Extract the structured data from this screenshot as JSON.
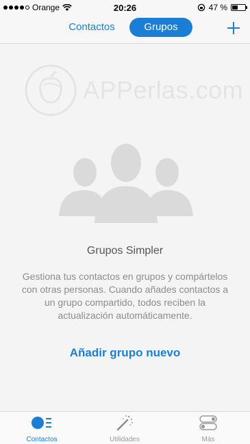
{
  "status_bar": {
    "carrier": "Orange",
    "time": "20:26",
    "battery": "47 %",
    "battery_level": 0.47
  },
  "header": {
    "segment_contactos": "Contactos",
    "segment_grupos": "Grupos",
    "add_icon": "plus-icon"
  },
  "watermark": {
    "text": "APPerlas.com"
  },
  "empty_state": {
    "icon": "people-group-icon",
    "title": "Grupos Simpler",
    "description": "Gestiona tus contactos en grupos y compártelos con otras personas. Cuando añades contactos a un grupo compartido, todos reciben la actualización automáticamente.",
    "action": "Añadir grupo nuevo"
  },
  "tabs": [
    {
      "label": "Contactos",
      "icon": "contacts-list-icon",
      "active": true
    },
    {
      "label": "Utilidades",
      "icon": "magic-wand-icon",
      "active": false
    },
    {
      "label": "Más",
      "icon": "more-toggles-icon",
      "active": false
    }
  ],
  "colors": {
    "accent": "#1a7fd4",
    "background": "#f4f4f4"
  }
}
